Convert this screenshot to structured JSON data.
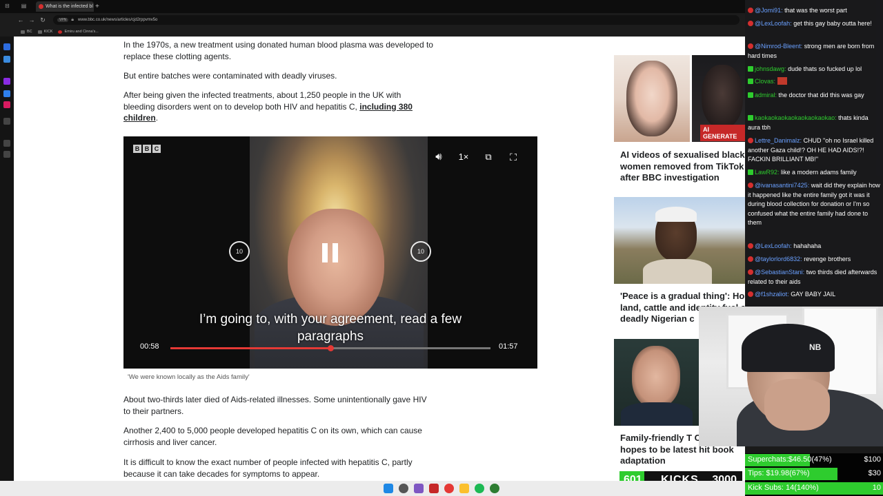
{
  "browser": {
    "tab_title": "What is the infected bl",
    "new_tab": "+",
    "url_prefix": "VPN",
    "url": "www.bbc.co.uk/news/articles/cjd2rppvmv5o",
    "bookmarks": [
      "BC",
      "KICK",
      "Emiru and Cinna's..."
    ]
  },
  "article": {
    "paragraphs": [
      "In the 1970s, a new treatment using donated human blood plasma was developed to replace these clotting agents.",
      "But entire batches were contaminated with deadly viruses.",
      "After being given the infected treatments, about 1,250 people in the UK with bleeding disorders went on to develop both HIV and hepatitis C,",
      "About two-thirds later died of Aids-related illnesses. Some unintentionally gave HIV to their partners.",
      "Another 2,400 to 5,000 people developed hepatitis C on its own, which can cause cirrhosis and liver cancer.",
      "It is difficult to know the exact number of people infected with hepatitis C, partly because it can take decades for symptoms to appear."
    ],
    "link_text": "including 380 children",
    "video_caption": "'We were known locally as the Aids family'"
  },
  "video": {
    "logo_letters": [
      "B",
      "B",
      "C"
    ],
    "speed": "1×",
    "skip_back": "10",
    "skip_forward": "10",
    "subtitle": "I’m going to, with your agreement, read a few paragraphs",
    "current_time": "00:58",
    "duration": "01:57",
    "progress": 0.5
  },
  "related": [
    {
      "title": "AI videos of sexualised black women removed from TikTok after BBC investigation",
      "badge": "AI GENERATE"
    },
    {
      "title": "'Peace is a gradual thing': Ho land, cattle and identity fuel a deadly Nigerian c"
    },
    {
      "title": "Family-friendly T Crookhaven hopes to be latest hit book adaptation"
    }
  ],
  "chat": [
    {
      "user": "@Jomi91:",
      "text": "that was the worst part",
      "color": "#6aa0ff"
    },
    {
      "user": "@LexLoofah:",
      "text": "get this gay baby outta here!",
      "color": "#6aa0ff"
    },
    {
      "user": "@Nimrod-Bleent:",
      "text": "strong men are born from hard times",
      "color": "#6aa0ff"
    },
    {
      "user": "johnsdawg:",
      "text": "dude thats so fucked up lol",
      "color": "#2ecc2e"
    },
    {
      "user": "Clovas:",
      "text": "",
      "color": "#2ecc2e"
    },
    {
      "user": "admiral:",
      "text": "the doctor that did this was gay",
      "color": "#2ecc2e"
    },
    {
      "user": "kaokaokaokaokaokaokaokao:",
      "text": "thats kinda aura tbh",
      "color": "#2ecc2e"
    },
    {
      "user": "Lettre_Danimalz:",
      "text": "CHUD \"oh no Israel killed another Gaza child!? OH HE HAD AIDS!?! FACKIN BRILLIANT MB!\"",
      "color": "#6aa0ff"
    },
    {
      "user": "LawR92:",
      "text": "like a modern adams family",
      "color": "#2ecc2e"
    },
    {
      "user": "@ivanasantini7425:",
      "text": "wait did they explain how it happened like the entire family got it was it during blood collection for donation or I'm so confused what the entire family had done to them",
      "color": "#6aa0ff"
    },
    {
      "user": "@LexLoofah:",
      "text": "hahahaha",
      "color": "#6aa0ff"
    },
    {
      "user": "@taylorlord6832:",
      "text": "revenge brothers",
      "color": "#6aa0ff"
    },
    {
      "user": "@SebastianStani:",
      "text": "two thirds died afterwards related to their aids",
      "color": "#6aa0ff"
    },
    {
      "user": "@f1shzaliot:",
      "text": "GAY BABY JAIL",
      "color": "#6aa0ff"
    }
  ],
  "goals": [
    {
      "label": "Superchats:",
      "value": "$46.50(47%)",
      "target": "$100",
      "fraction": 0.47
    },
    {
      "label": "Tips:",
      "value": "$19.98(67%)",
      "target": "$30",
      "fraction": 0.67
    },
    {
      "label": "Kick Subs:",
      "value": "14(140%)",
      "target": "10",
      "fraction": 1.0
    }
  ],
  "kicks": {
    "current": "601",
    "label": "KICKS",
    "goal": "3000",
    "fraction": 0.2
  }
}
